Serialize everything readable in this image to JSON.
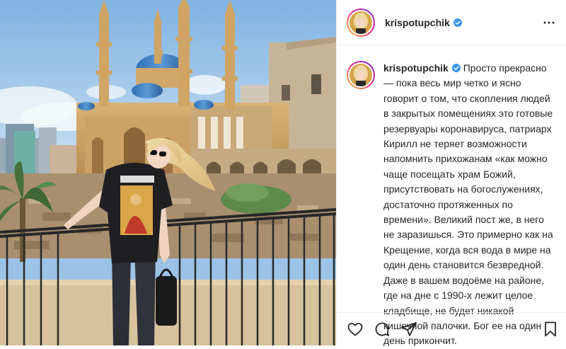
{
  "post": {
    "username": "krispotupchik",
    "caption": "Просто прекрасно — пока весь мир четко и ясно говорит о том, что скопления людей в закрытых помещениях это готовые резервуары коронавируса, патриарх Кирилл не теряет возможности напомнить прихожанам «как можно чаще посещать храм Божий, присутствовать на богослужениях, достаточно протяженных по времени». Великий пост же, в него не заразишься. Это примерно как на Крещение, когда вся вода в мире на один день становится безвредной. Даже в вашем водоёме на районе, где на дне с 1990-х лежит целое кладбище, не будет никакой кишечной палочки. Бог ее на один день прикончит.",
    "more_icon": "⋯"
  },
  "icons": {
    "verified": "verified-badge-icon",
    "like": "heart-icon",
    "comment": "comment-icon",
    "share": "share-icon",
    "save": "bookmark-icon"
  },
  "colors": {
    "verified": "#3897f0",
    "text": "#262626",
    "border": "#efefef"
  }
}
